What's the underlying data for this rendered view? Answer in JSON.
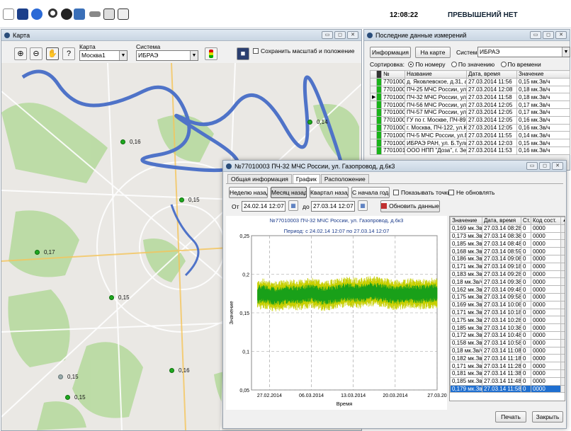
{
  "status": {
    "time": "12:08:22",
    "alarm": "ПРЕВЫШЕНИЙ НЕТ"
  },
  "toolbar": {
    "icons": [
      "new-icon",
      "save-icon",
      "refresh-icon",
      "search-icon",
      "info-icon",
      "network-icon",
      "key-icon",
      "windows-icon",
      "report-icon"
    ]
  },
  "map_window": {
    "title": "Карта",
    "karta_label": "Карта",
    "karta_value": "Москва1",
    "sistema_label": "Система",
    "sistema_value": "ИБРАЭ",
    "save_scale_label": "Сохранить масштаб и положение",
    "markers": [
      "0,14",
      "0,16",
      "0,15",
      "0,17",
      "0,15",
      "0,16",
      "0,15",
      "0,15"
    ]
  },
  "last_data_window": {
    "title": "Последние данные измерений",
    "info_button": "Информация",
    "map_button": "На карте",
    "sistema_label": "Система",
    "sistema_value": "ИБРАЭ",
    "sort_label": "Сортировка:",
    "sort_options": [
      "По номеру",
      "По значению",
      "По времени"
    ],
    "columns": [
      "№",
      "Название",
      "Дата, время",
      "Значение"
    ],
    "rows": [
      [
        "77010001",
        "д. Яковлевское, д.31, админист",
        "27.03.2014 11:56",
        "0,15 мк.Зв/ч"
      ],
      [
        "77010002",
        "ПЧ-25 МЧС России, ул. Студенч",
        "27.03.2014 12:08",
        "0,18 мк.Зв/ч"
      ],
      [
        "77010003",
        "ПЧ-32 МЧС России, ул. Газопро",
        "27.03.2014 11:58",
        "0,18 мк.Зв/ч"
      ],
      [
        "77010004",
        "ПЧ-56 МЧС России, ул. Вводен",
        "27.03.2014 12:05",
        "0,17 мк.Зв/ч"
      ],
      [
        "77010005",
        "ПЧ-57 МЧС России, ул. Озерна",
        "27.03.2014 12:05",
        "0,17 мк.Зв/ч"
      ],
      [
        "77010006",
        "ГУ по г. Москве, ПЧ-89, ул.Шен",
        "27.03.2014 12:05",
        "0,16 мк.Зв/ч"
      ],
      [
        "77010007",
        "г. Москва, ПЧ-122, ул.Корганск",
        "27.03.2014 12:05",
        "0,16 мк.Зв/ч"
      ],
      [
        "77010008",
        "ПЧ-5 МЧС России, ул.Владимир",
        "27.03.2014 11:55",
        "0,14 мк.Зв/ч"
      ],
      [
        "77010009",
        "ИБРАЭ РАН, ул. Б.Тульская, д.",
        "27.03.2014 12:03",
        "0,15 мк.Зв/ч"
      ],
      [
        "77010010",
        "ООО НПП \"Доза\", г. Зеленоград",
        "27.03.2014 11:53",
        "0,16 мк.Зв/ч"
      ]
    ]
  },
  "detail_window": {
    "title": "№77010003 ПЧ-32 МЧС России, ул. Газопровод, д.6к3",
    "tabs": [
      "Общая информация",
      "График",
      "Расположение"
    ],
    "range_buttons": [
      "Неделю назад",
      "Месяц назад",
      "Квартал назад",
      "С начала года"
    ],
    "show_points_label": "Показывать точки",
    "no_update_label": "Не обновлять",
    "from_label": "От",
    "from_value": "24.02.14 12:07",
    "to_label": "до",
    "to_value": "27.03.14 12:07",
    "refresh_button": "Обновить данные",
    "chart_title": "№77010003 ПЧ-32 МЧС России, ул. Газопровод, д.6к3",
    "chart_period": "Период: с 24.02.14 12:07 по 27.03.14 12:07",
    "columns": [
      "Значение",
      "Дата, время",
      "Ст.",
      "Код сост."
    ],
    "rows": [
      [
        "0,169 мк.Зв/ч",
        "27.03.14 08:28",
        "0",
        "0000"
      ],
      [
        "0,173 мк.Зв/ч",
        "27.03.14 08:38",
        "0",
        "0000"
      ],
      [
        "0,185 мк.Зв/ч",
        "27.03.14 08:48",
        "0",
        "0000"
      ],
      [
        "0,168 мк.Зв/ч",
        "27.03.14 08:59",
        "0",
        "0000"
      ],
      [
        "0,186 мк.Зв/ч",
        "27.03.14 09:08",
        "0",
        "0000"
      ],
      [
        "0,171 мк.Зв/ч",
        "27.03.14 09:18",
        "0",
        "0000"
      ],
      [
        "0,183 мк.Зв/ч",
        "27.03.14 09:28",
        "0",
        "0000"
      ],
      [
        "0,18 мк.Зв/ч",
        "27.03.14 09:38",
        "0",
        "0000"
      ],
      [
        "0,162 мк.Зв/ч",
        "27.03.14 09:48",
        "0",
        "0000"
      ],
      [
        "0,175 мк.Зв/ч",
        "27.03.14 09:58",
        "0",
        "0000"
      ],
      [
        "0,169 мк.Зв/ч",
        "27.03.14 10:08",
        "0",
        "0000"
      ],
      [
        "0,171 мк.Зв/ч",
        "27.03.14 10:18",
        "0",
        "0000"
      ],
      [
        "0,175 мк.Зв/ч",
        "27.03.14 10:28",
        "0",
        "0000"
      ],
      [
        "0,185 мк.Зв/ч",
        "27.03.14 10:38",
        "0",
        "0000"
      ],
      [
        "0,172 мк.Зв/ч",
        "27.03.14 10:48",
        "0",
        "0000"
      ],
      [
        "0,158 мк.Зв/ч",
        "27.03.14 10:58",
        "0",
        "0000"
      ],
      [
        "0,18 мк.Зв/ч",
        "27.03.14 11:08",
        "0",
        "0000"
      ],
      [
        "0,182 мк.Зв/ч",
        "27.03.14 11:18",
        "0",
        "0000"
      ],
      [
        "0,171 мк.Зв/ч",
        "27.03.14 11:28",
        "0",
        "0000"
      ],
      [
        "0,181 мк.Зв/ч",
        "27.03.14 11:38",
        "0",
        "0000"
      ],
      [
        "0,185 мк.Зв/ч",
        "27.03.14 11:48",
        "0",
        "0000"
      ],
      [
        "0,179 мк.Зв/ч",
        "27.03.14 11:58",
        "0",
        "0000"
      ]
    ],
    "print_button": "Печать",
    "close_button": "Закрыть"
  },
  "chart_data": {
    "type": "line",
    "title": "№77010003 ПЧ-32 МЧС России, ул. Газопровод, д.6к3",
    "subtitle": "Период: с 24.02.14 12:07 по 27.03.14 12:07",
    "xlabel": "Время",
    "ylabel": "Значение",
    "ylim": [
      0.05,
      0.25
    ],
    "xlim": [
      "24.02.2014",
      "27.03.2014"
    ],
    "yticks": [
      "0,25",
      "0,2",
      "0,15",
      "0,1",
      "0,05"
    ],
    "xticks": [
      "27.02.2014",
      "06.03.2014",
      "13.03.2014",
      "20.03.2014",
      "27.03.20"
    ],
    "grid": true,
    "colors": {
      "series": "#19a019",
      "band": "#c7cf00"
    },
    "series": [
      {
        "x": [
          "24.02.2014",
          "26.02.2014",
          "28.02.2014",
          "02.03.2014",
          "04.03.2014",
          "06.03.2014",
          "08.03.2014",
          "10.03.2014",
          "12.03.2014",
          "14.03.2014",
          "16.03.2014",
          "18.03.2014",
          "20.03.2014",
          "22.03.2014",
          "24.03.2014",
          "27.03.2014"
        ],
        "values": [
          0.172,
          0.175,
          0.171,
          0.174,
          0.173,
          0.176,
          0.172,
          0.174,
          0.177,
          0.175,
          0.178,
          0.176,
          0.173,
          0.175,
          0.174,
          0.176
        ]
      }
    ]
  }
}
